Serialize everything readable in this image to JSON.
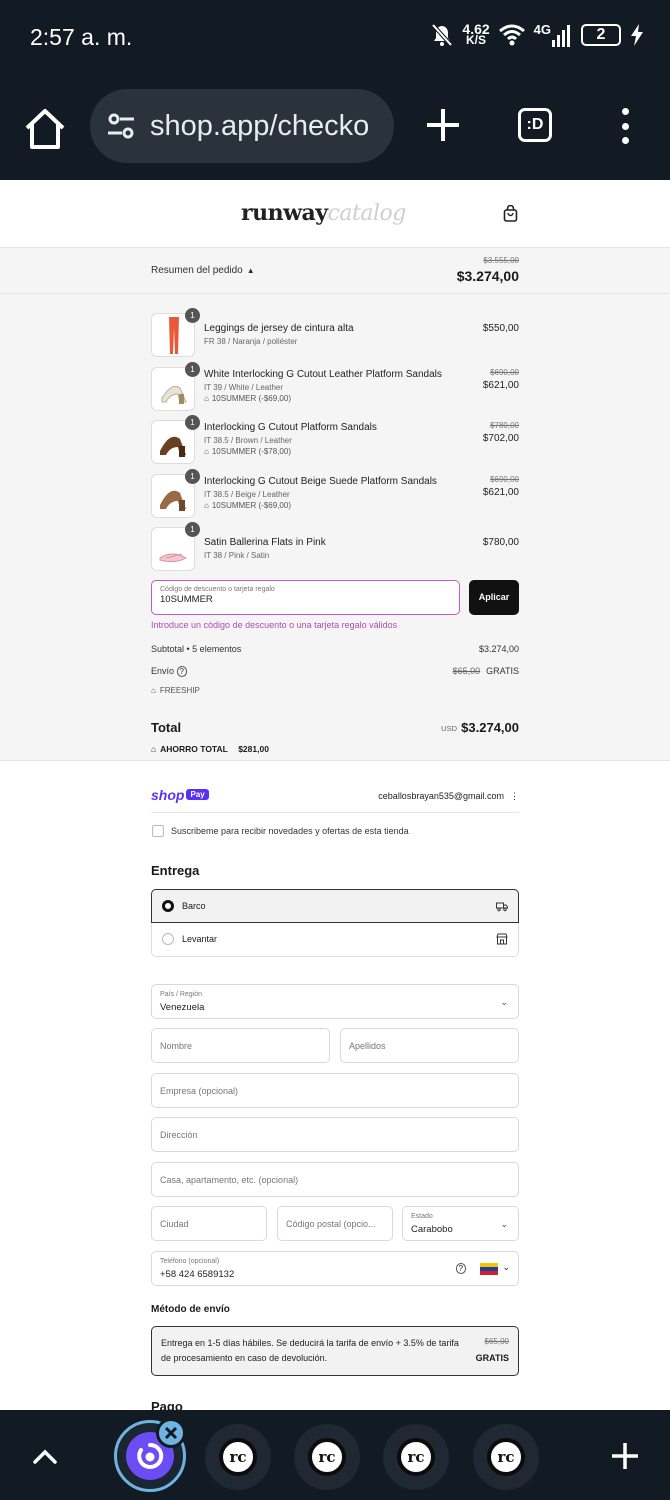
{
  "status_bar": {
    "time": "2:57 a. m.",
    "net_speed_value": "4.62",
    "net_speed_unit": "K/S",
    "network": "4G",
    "battery": "2",
    "icons": [
      "mute-bell-icon",
      "wifi-icon",
      "signal-icon",
      "battery-icon",
      "charging-bolt-icon"
    ]
  },
  "browser": {
    "url": "shop.app/checko",
    "tabs_label": ":D"
  },
  "store": {
    "logo_bold": "runway",
    "logo_light": "catalog"
  },
  "summary": {
    "toggle_label": "Resumen del pedido",
    "original_total": "$3.555,00",
    "total": "$3.274,00",
    "items": [
      {
        "qty": "1",
        "name": "Leggings de jersey de cintura alta",
        "variant": "FR 38 / Naranja / poliéster",
        "discount": "",
        "old_price": "",
        "price": "$550,00",
        "thumb": "orange-leggings"
      },
      {
        "qty": "1",
        "name": "White Interlocking G Cutout Leather Platform Sandals",
        "variant": "IT 39 / White / Leather",
        "discount": "10SUMMER (-$69,00)",
        "old_price": "$690,00",
        "price": "$621,00",
        "thumb": "white-sandal"
      },
      {
        "qty": "1",
        "name": "Interlocking G Cutout Platform Sandals",
        "variant": "IT 38.5 / Brown / Leather",
        "discount": "10SUMMER (-$78,00)",
        "old_price": "$780,00",
        "price": "$702,00",
        "thumb": "brown-sandal"
      },
      {
        "qty": "1",
        "name": "Interlocking G Cutout Beige Suede Platform Sandals",
        "variant": "IT 38.5 / Beige / Leather",
        "discount": "10SUMMER (-$69,00)",
        "old_price": "$690,00",
        "price": "$621,00",
        "thumb": "beige-sandal"
      },
      {
        "qty": "1",
        "name": "Satin Ballerina Flats in Pink",
        "variant": "IT 38 / Pink / Satin",
        "discount": "",
        "old_price": "",
        "price": "$780,00",
        "thumb": "pink-flats"
      }
    ],
    "discount_field": {
      "label": "Código de descuento o tarjeta regalo",
      "value": "10SUMMER",
      "apply": "Aplicar",
      "error": "Introduce un código de descuento o una tarjeta regalo válidos"
    },
    "subtotal_label": "Subtotal • 5 elementos",
    "subtotal_value": "$3.274,00",
    "shipping_label": "Envío",
    "shipping_old": "$65,00",
    "shipping_value": "GRATIS",
    "shipping_code": "FREESHIP",
    "total_label": "Total",
    "currency": "USD",
    "total_value": "$3.274,00",
    "savings_label": "AHORRO TOTAL",
    "savings_value": "$281,00"
  },
  "checkout": {
    "shop_pay_word": "shop",
    "shop_pay_badge": "Pay",
    "email": "ceballosbrayan535@gmail.com",
    "subscribe": "Suscribeme para recibir novedades y ofertas de esta tienda",
    "delivery_title": "Entrega",
    "delivery_options": [
      {
        "label": "Barco",
        "selected": true
      },
      {
        "label": "Levantar",
        "selected": false
      }
    ],
    "country_label": "País / Región",
    "country_value": "Venezuela",
    "first_name": "Nombre",
    "last_name": "Apellidos",
    "company": "Empresa (opcional)",
    "address": "Dirección",
    "apartment": "Casa, apartamento, etc. (opcional)",
    "city": "Ciudad",
    "postal_code": "Código postal (opcio...",
    "state_label": "Estado",
    "state_value": "Carabobo",
    "phone_label": "Teléfono (opcional)",
    "phone_value": "+58 424 6589132",
    "shipping_method_title": "Método de envío",
    "shipping_method_desc": "Entrega en 1-5 días hábiles. Se deducirá la tarifa de envío + 3.5% de tarifa de procesamiento en caso de devolución.",
    "shipping_method_old": "$65,00",
    "shipping_method_price": "GRATIS",
    "payment_title": "Pago"
  },
  "colors": {
    "chrome_bg": "#121a24",
    "shop_pay": "#5a31f4",
    "error": "#b24ab6",
    "active_tab_ring": "#6fb4e0"
  },
  "tab_strip": {
    "tab_icon_text": "rc",
    "tab_count": 4
  }
}
